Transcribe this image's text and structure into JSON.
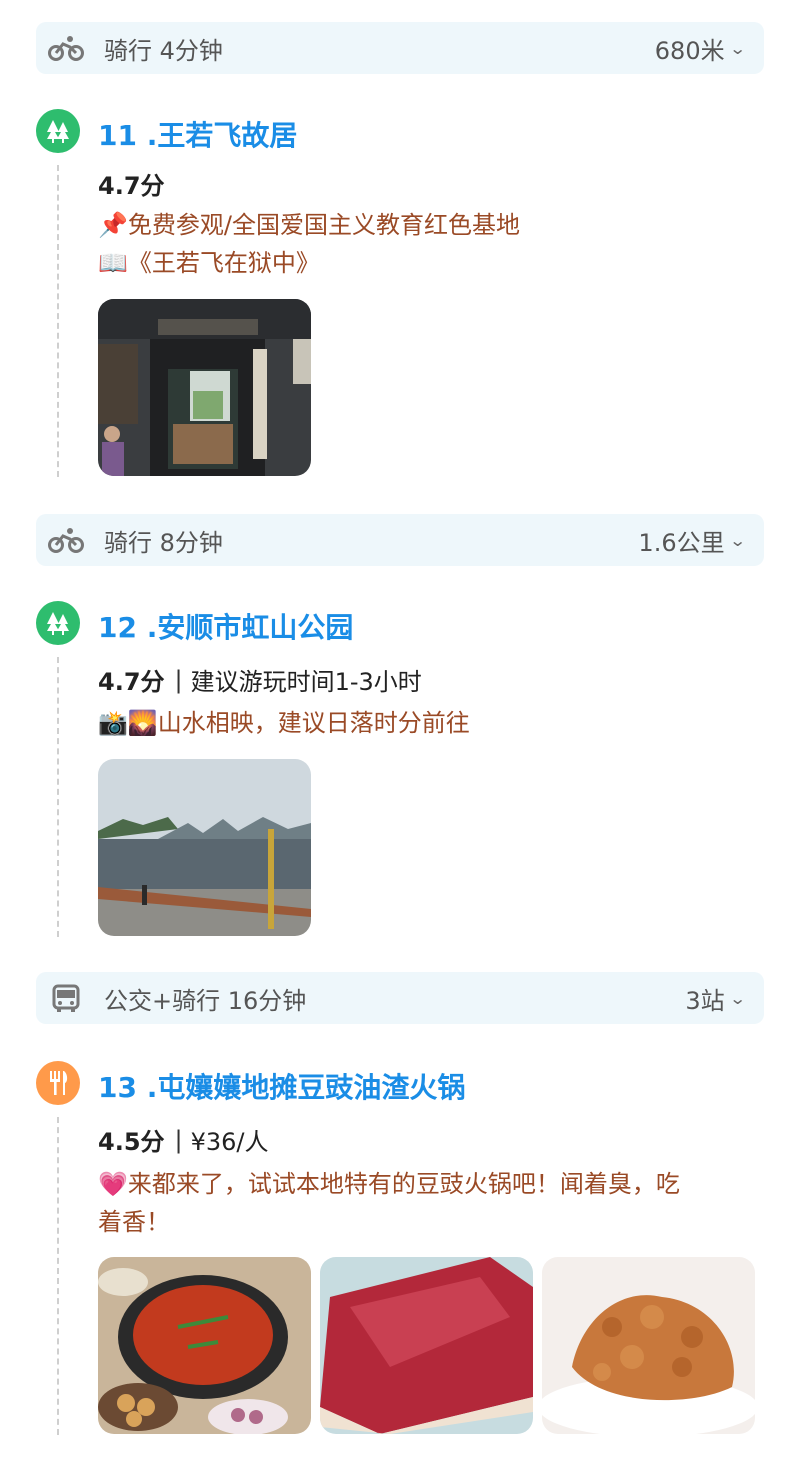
{
  "segments": [
    {
      "mode_icon": "bike-icon",
      "label": "骑行 4分钟",
      "distance": "680米"
    },
    {
      "mode_icon": "bike-icon",
      "label": "骑行 8分钟",
      "distance": "1.6公里"
    },
    {
      "mode_icon": "bus-icon",
      "label": "公交+骑行 16分钟",
      "distance": "3站"
    }
  ],
  "pois": [
    {
      "icon": "tree-icon",
      "title": "11 .王若飞故居",
      "score": "4.7分",
      "desc_lines": [
        "📌免费参观/全国爱国主义教育红色基地",
        "📖《王若飞在狱中》"
      ]
    },
    {
      "icon": "tree-icon",
      "title": "12 .安顺市虹山公园",
      "score": "4.7分",
      "extra": "建议游玩时间1-3小时",
      "desc_lines": [
        "📸🌄山水相映，建议日落时分前往"
      ]
    },
    {
      "icon": "fork-knife-icon",
      "title": "13 .屯孃孃地摊豆豉油渣火锅",
      "score": "4.5分",
      "extra": "¥36/人",
      "desc_lines": [
        "💗来都来了，试试本地特有的豆豉火锅吧！闻着臭，吃",
        "着香！"
      ]
    }
  ],
  "colors": {
    "accent_title": "#1a8de6",
    "desc_text": "#9a4a26",
    "transit_bg": "#eef7fb",
    "poi_green": "#2ebd6e",
    "poi_orange": "#ff9a4a"
  }
}
